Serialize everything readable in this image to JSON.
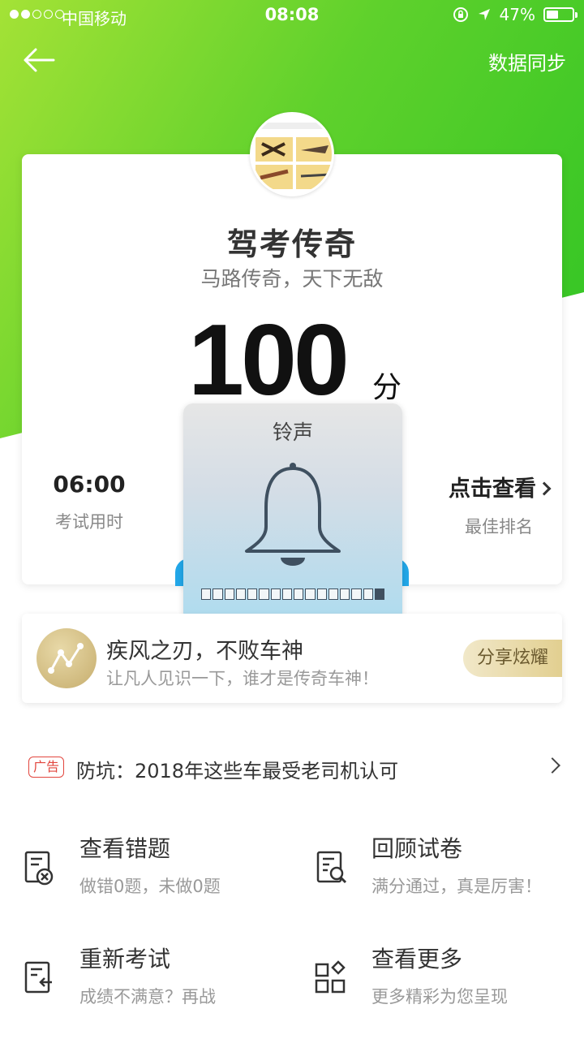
{
  "status": {
    "carrier": "中国移动",
    "time": "08:08",
    "battery_pct": "47%",
    "battery_level": 0.47,
    "signal_bars": 2,
    "icons": [
      "orientation-lock-icon",
      "location-icon",
      "battery-icon"
    ]
  },
  "nav": {
    "back_icon": "back-arrow-icon",
    "sync_label": "数据同步"
  },
  "result": {
    "title": "驾考传奇",
    "subtitle": "马路传奇，天下无敌",
    "score": "100",
    "score_unit": "分",
    "time_value": "06:00",
    "time_label": "考试用时",
    "rank_value": "点击查看",
    "rank_label": "最佳排名"
  },
  "ringer": {
    "title": "铃声",
    "icon": "bell-icon",
    "level": 1.0
  },
  "achievement": {
    "title": "疾风之刃，不败车神",
    "subtitle": "让凡人见识一下，谁才是传奇车神！",
    "share_label": "分享炫耀"
  },
  "ad": {
    "tag": "广告",
    "text": "防坑：2018年这些车最受老司机认可"
  },
  "actions": [
    {
      "title": "查看错题",
      "subtitle": "做错0题，未做0题",
      "icon": "wrong-questions-icon"
    },
    {
      "title": "回顾试卷",
      "subtitle": "满分通过，真是厉害！",
      "icon": "review-paper-icon"
    },
    {
      "title": "重新考试",
      "subtitle": "成绩不满意？再战",
      "icon": "retake-exam-icon"
    },
    {
      "title": "查看更多",
      "subtitle": "更多精彩为您呈现",
      "icon": "more-apps-icon"
    }
  ],
  "colors": {
    "header_green": "#5fd12c",
    "ad_red": "#e2463e",
    "gold": "#c6ad6d"
  }
}
